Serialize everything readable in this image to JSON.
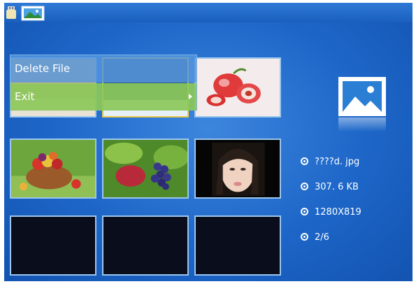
{
  "topbar": {
    "icons": [
      "usb-stick-icon",
      "picture-folder-icon"
    ]
  },
  "context_menu": {
    "items": [
      {
        "label": "Delete File",
        "submenu": false
      },
      {
        "label": "Exit",
        "submenu": true
      }
    ]
  },
  "thumbnails": [
    {
      "content": "photo",
      "hidden_behind_menu": true
    },
    {
      "content": "photo",
      "hidden_behind_menu": true,
      "selected": true
    },
    {
      "content": "peaches-photo"
    },
    {
      "content": "fruit-basket-photo"
    },
    {
      "content": "grapes-photo"
    },
    {
      "content": "portrait-photo"
    },
    {
      "content": "empty"
    },
    {
      "content": "empty"
    },
    {
      "content": "empty"
    }
  ],
  "file_info": {
    "preview_icon": "picture-icon",
    "filename": "????d. jpg",
    "size": "307. 6 KB",
    "resolution": "1280X819",
    "index": "2/6"
  },
  "colors": {
    "background": "#1d66c8",
    "menu_highlight": "#8cc85a",
    "thumbnail_border": "#9bc6ee",
    "selected_border": "#e8c84a"
  }
}
